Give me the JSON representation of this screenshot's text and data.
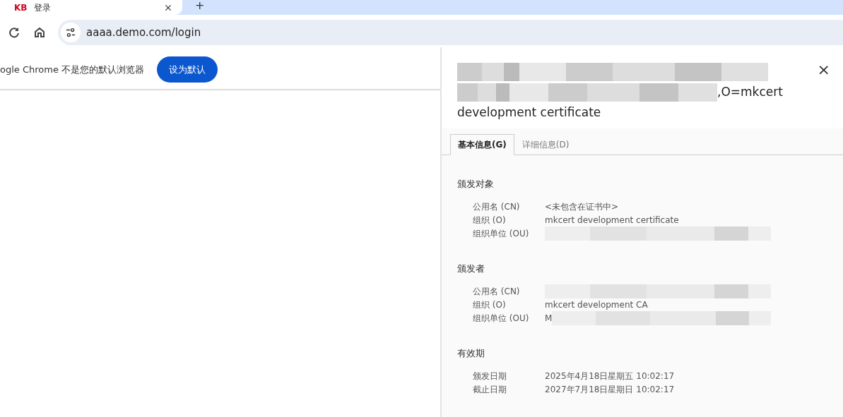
{
  "browser": {
    "tab": {
      "logo": "KB",
      "title": "登录",
      "selected": true
    },
    "new_tab": "+",
    "address": "aaaa.demo.com/login"
  },
  "infobar": {
    "message": "ogle Chrome 不是您的默认浏览器",
    "button": "设为默认"
  },
  "dialog": {
    "title_tail": ",O=mkcert",
    "title_line": "development certificate",
    "close": "×",
    "tabs": [
      {
        "label": "基本信息(G)",
        "selected": true
      },
      {
        "label": "详细信息(D)",
        "selected": false
      }
    ],
    "sections": [
      {
        "heading": "颁发对象",
        "rows": [
          {
            "label": "公用名 (CN)",
            "value": "<未包含在证书中>"
          },
          {
            "label": "组织 (O)",
            "value": "mkcert development certificate"
          },
          {
            "label": "组织单位 (OU)",
            "kind": "redacted"
          }
        ]
      },
      {
        "heading": "颁发者",
        "rows": [
          {
            "label": "公用名 (CN)",
            "kind": "redacted"
          },
          {
            "label": "组织 (O)",
            "value": "mkcert development CA"
          },
          {
            "label": "组织单位 (OU)",
            "value": "M",
            "kind": "redacted"
          }
        ]
      },
      {
        "heading": "有效期",
        "rows": [
          {
            "label": "颁发日期",
            "value": "2025年4月18日星期五 10:02:17"
          },
          {
            "label": "截止日期",
            "value": "2027年7月18日星期日 10:02:17"
          }
        ]
      }
    ]
  }
}
